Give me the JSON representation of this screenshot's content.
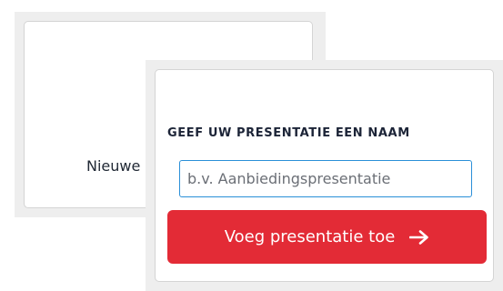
{
  "tile": {
    "label": "Nieuwe presentatie",
    "icon": "presentation-icon"
  },
  "popover": {
    "title": "GEEF UW PRESENTATIE EEN NAAM",
    "input": {
      "value": "",
      "placeholder": "b.v. Aanbiedingspresentatie"
    },
    "submit": {
      "label": "Voeg presentatie toe",
      "icon": "arrow-right-icon"
    }
  },
  "colors": {
    "accent": "#e32b36",
    "focus_border": "#2a8fd8",
    "text_dark": "#1c2437",
    "frame_bg": "#eeeeee"
  }
}
